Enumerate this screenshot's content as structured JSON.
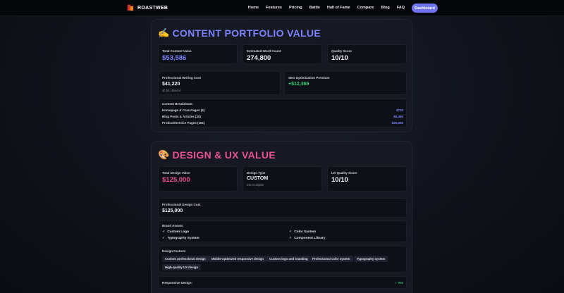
{
  "nav": {
    "brand": "ROASTWEB",
    "links": [
      "Home",
      "Features",
      "Pricing",
      "Battle",
      "Hall of Fame",
      "Compare",
      "Blog",
      "FAQ"
    ],
    "dashboard": "Dashboard"
  },
  "content": {
    "emoji": "✍️",
    "title": "CONTENT PORTFOLIO VALUE",
    "title_color": "#7b82ff",
    "total_label": "Total Content Value",
    "total_value": "$53,586",
    "words_label": "Estimated Word Count",
    "words_value": "274,800",
    "quality_label": "Quality Score",
    "quality_value": "10/10",
    "writing_label": "Professional Writing Cost",
    "writing_value": "$41,220",
    "writing_sub": "@ $0.15/word",
    "seo_label": "SEO Optimization Premium",
    "seo_value": "+$12,366",
    "seo_color": "#3ecf7a",
    "breakdown_label": "Content Breakdown:",
    "breakdown": [
      {
        "label": "Homepage & Core Pages (8)",
        "value": "$720"
      },
      {
        "label": "Blog Posts & Articles (30)",
        "value": "$6,480"
      },
      {
        "label": "Product/Service Pages (191)",
        "value": "$20,055"
      }
    ]
  },
  "design": {
    "emoji": "🎨",
    "title": "DESIGN & UX VALUE",
    "title_color": "#e8528f",
    "total_label": "Total Design Value",
    "total_value": "$125,000",
    "type_label": "Design Type",
    "type_value": "CUSTOM",
    "type_sub": "25x multiplier",
    "ux_label": "UX Quality Score",
    "ux_value": "10/10",
    "pro_label": "Professional Design Cost",
    "pro_value": "$125,000",
    "assets_label": "Brand Assets:",
    "assets": [
      "Custom Logo",
      "Color System",
      "Typography System",
      "Component Library"
    ],
    "factors_label": "Design Factors:",
    "factors": [
      "Custom professional design",
      "Mobile-optimized responsive design",
      "Custom logo and branding",
      "Professional color system",
      "Typography system",
      "High-quality UX design"
    ],
    "responsive_label": "Responsive Design:",
    "responsive_value": "✓ Yes",
    "responsive_color": "#3ecf7a"
  }
}
